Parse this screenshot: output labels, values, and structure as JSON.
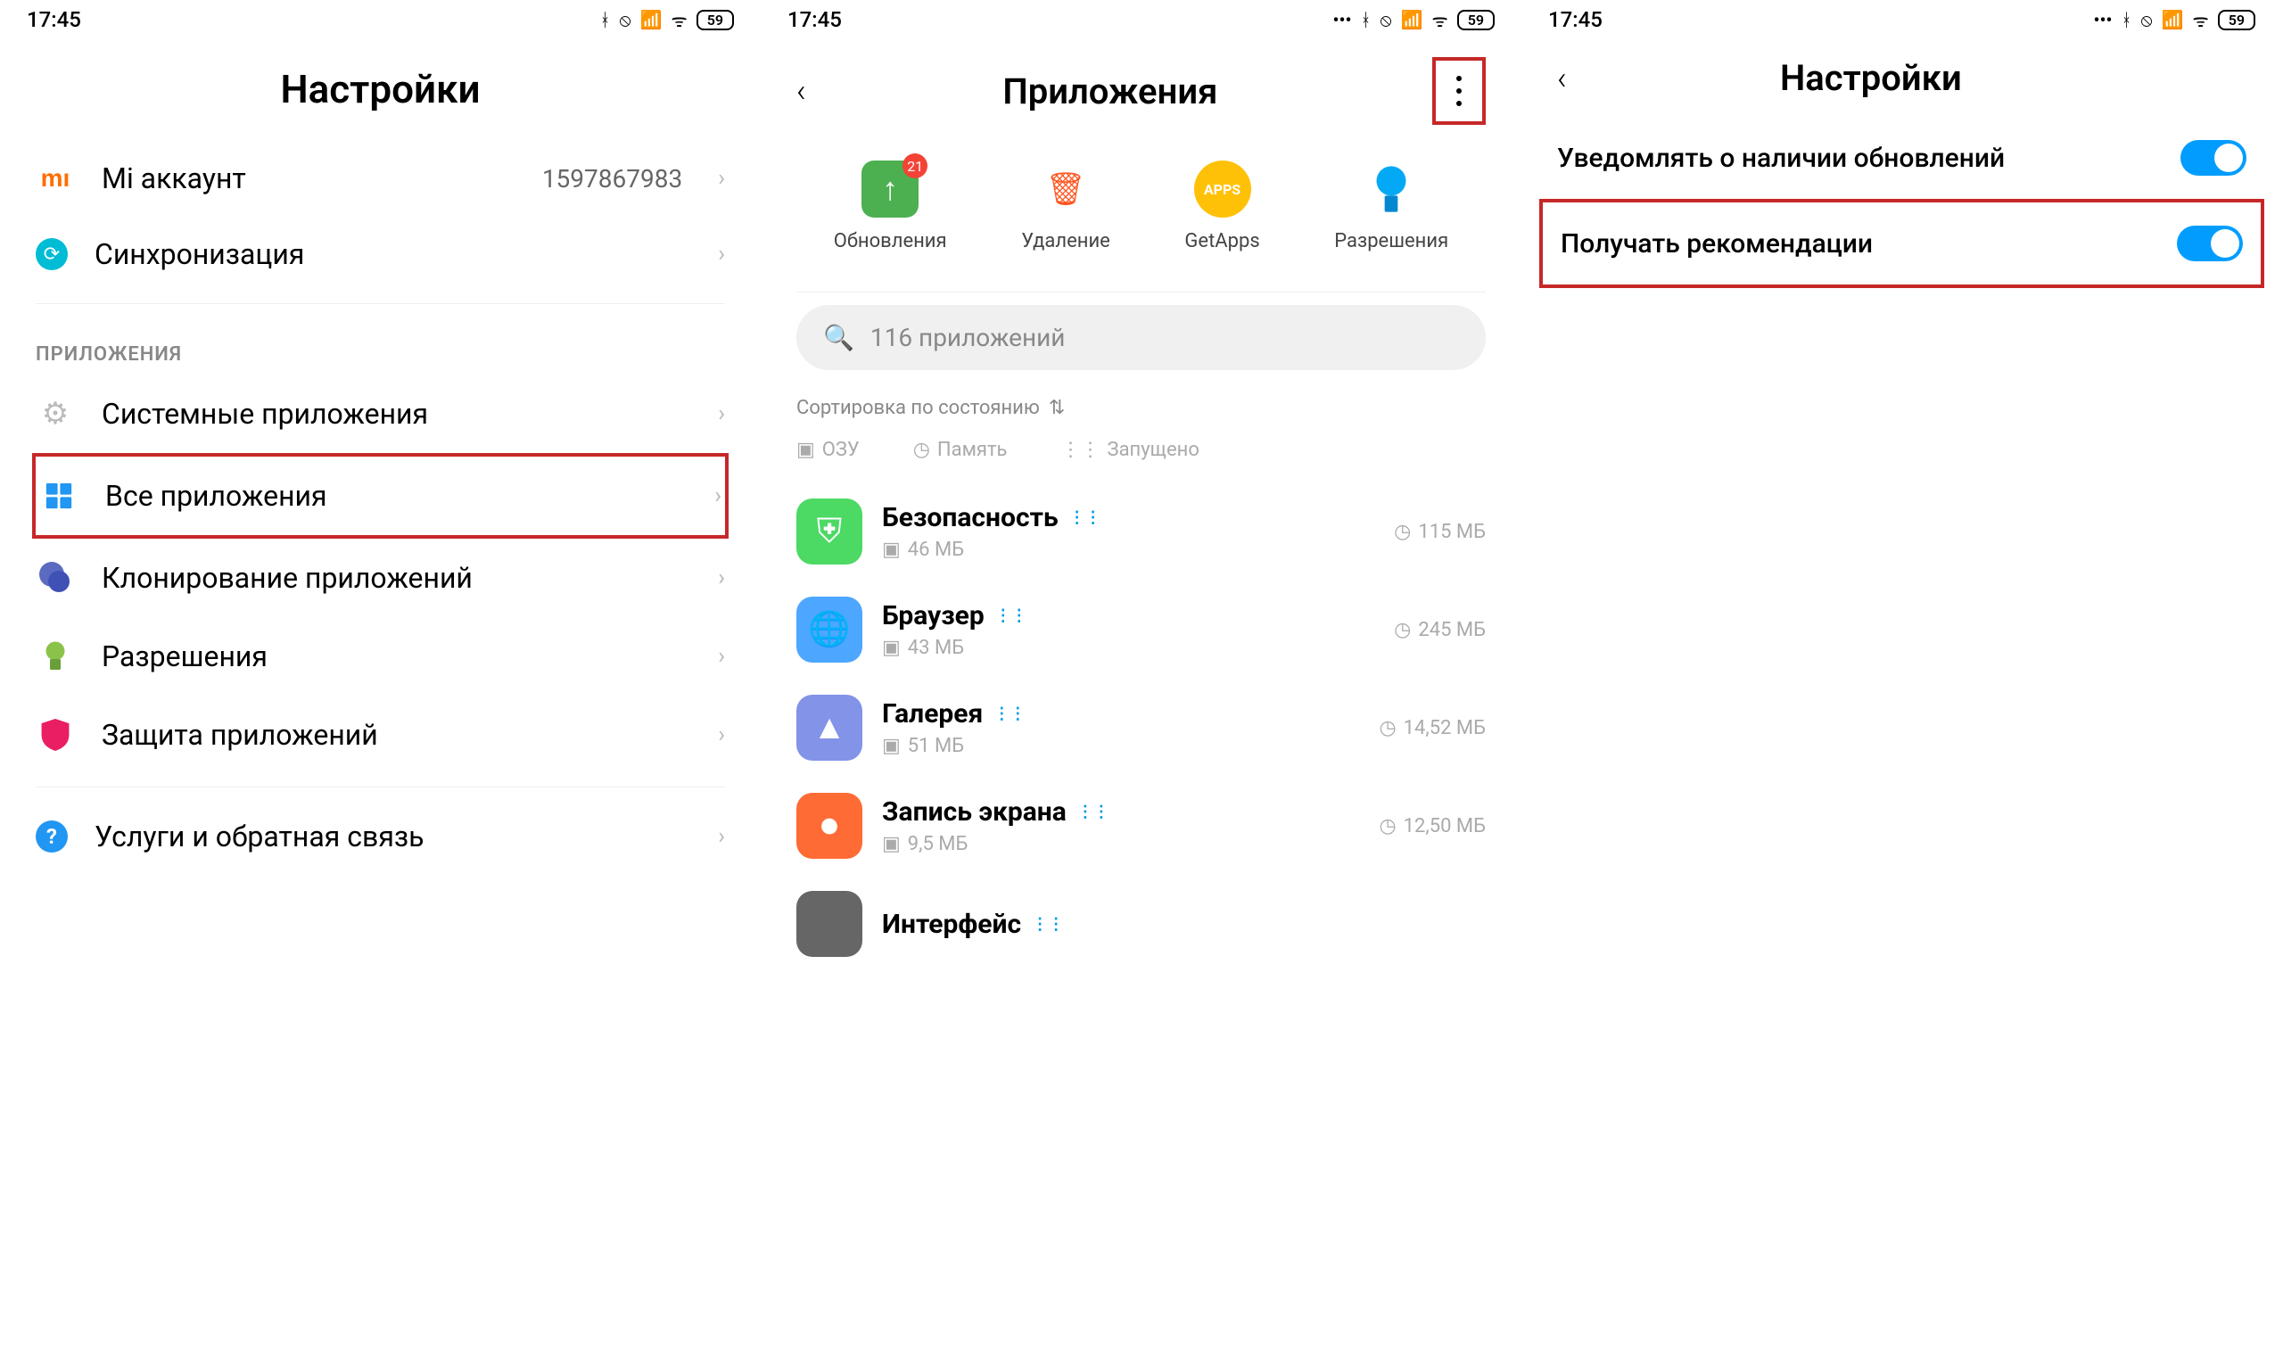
{
  "status": {
    "time": "17:45",
    "battery": "59"
  },
  "screen1": {
    "title": "Настройки",
    "miAccount": {
      "label": "Mi аккаунт",
      "value": "1597867983"
    },
    "sync": {
      "label": "Синхронизация"
    },
    "sectionApps": "ПРИЛОЖЕНИЯ",
    "systemApps": {
      "label": "Системные приложения"
    },
    "allApps": {
      "label": "Все приложения"
    },
    "cloning": {
      "label": "Клонирование приложений"
    },
    "permissions": {
      "label": "Разрешения"
    },
    "appProtection": {
      "label": "Защита приложений"
    },
    "feedback": {
      "label": "Услуги и обратная связь"
    }
  },
  "screen2": {
    "title": "Приложения",
    "qa": {
      "updates": {
        "label": "Обновления",
        "badge": "21"
      },
      "delete": {
        "label": "Удаление"
      },
      "getapps": {
        "label": "GetApps"
      },
      "permissions": {
        "label": "Разрешения"
      }
    },
    "searchPlaceholder": "116 приложений",
    "sort": "Сортировка по состоянию",
    "filters": {
      "ram": "ОЗУ",
      "memory": "Память",
      "running": "Запущено"
    },
    "apps": [
      {
        "name": "Безопасность",
        "ram": "46 МБ",
        "mem": "115 МБ",
        "iconBg": "#4cd964"
      },
      {
        "name": "Браузер",
        "ram": "43 МБ",
        "mem": "245 МБ",
        "iconBg": "#4da6ff"
      },
      {
        "name": "Галерея",
        "ram": "51 МБ",
        "mem": "14,52 МБ",
        "iconBg": "#8393e8"
      },
      {
        "name": "Запись экрана",
        "ram": "9,5 МБ",
        "mem": "12,50 МБ",
        "iconBg": "#ff6b35"
      },
      {
        "name": "Интерфейс",
        "ram": "",
        "mem": "",
        "iconBg": "#666"
      }
    ]
  },
  "screen3": {
    "title": "Настройки",
    "notifyUpdates": "Уведомлять о наличии обновлений",
    "recommendations": "Получать рекомендации"
  }
}
